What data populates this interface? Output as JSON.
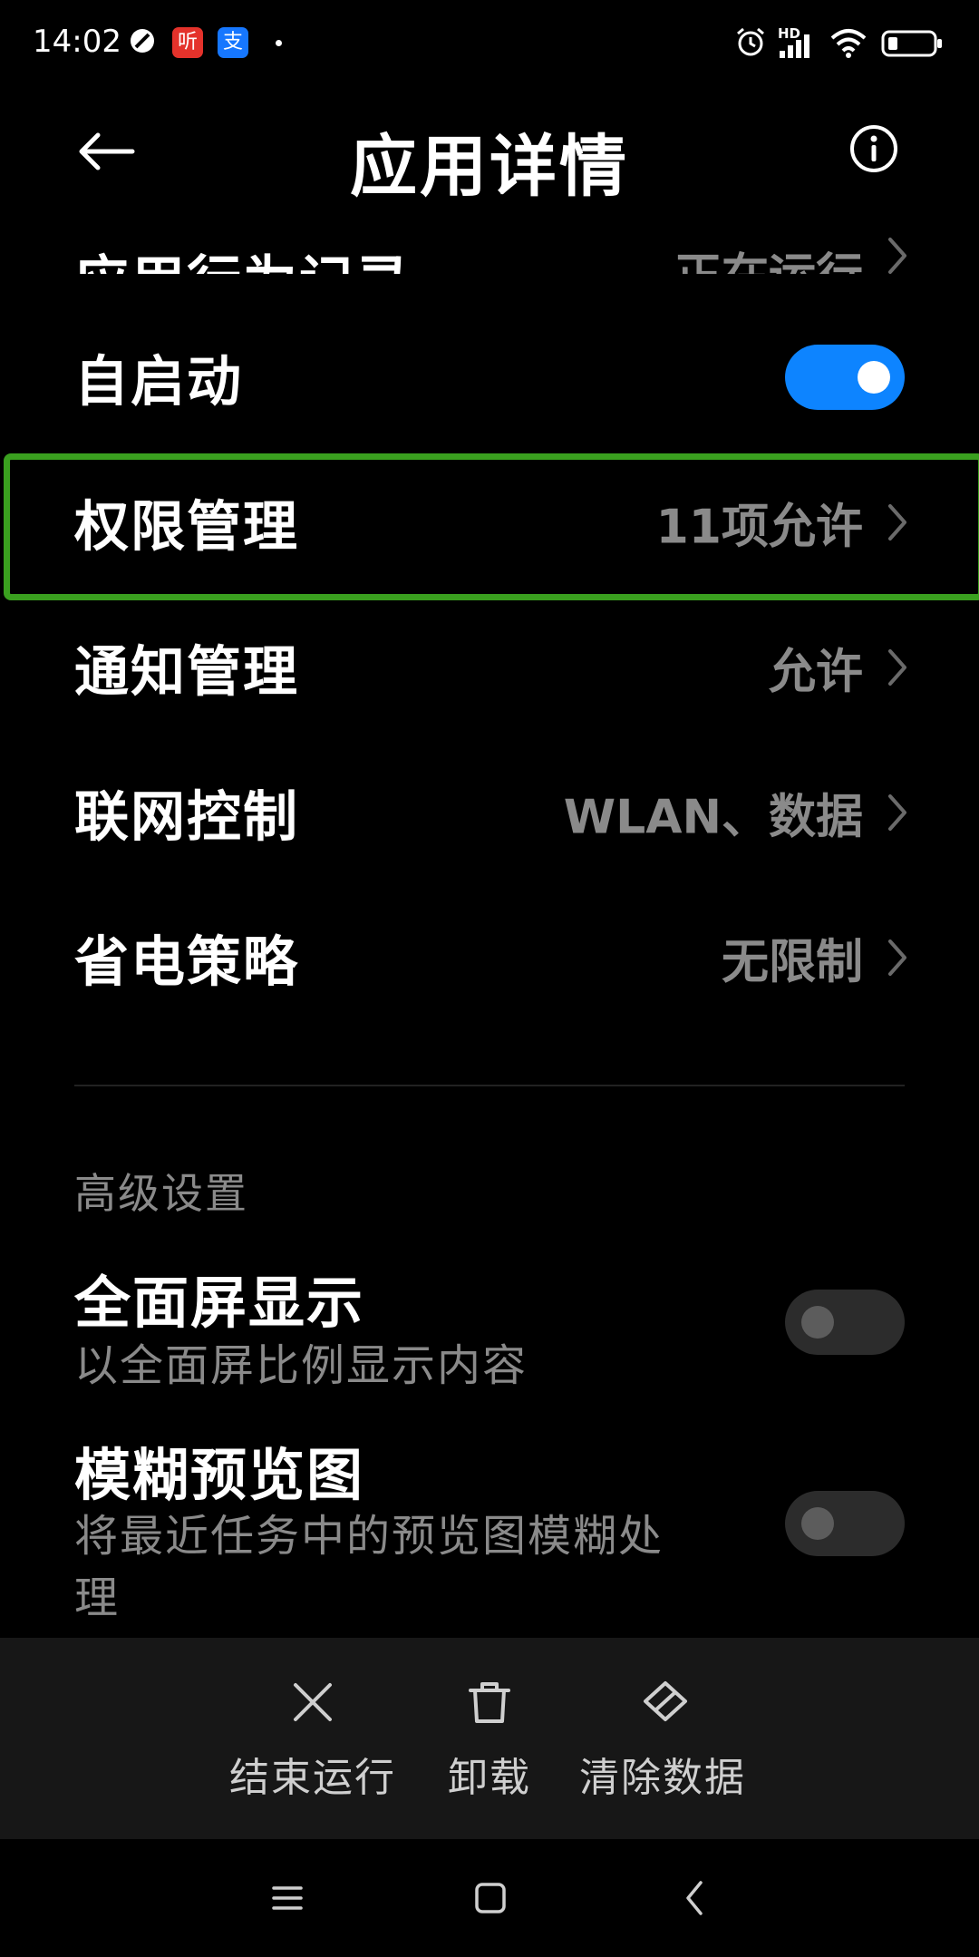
{
  "status_bar": {
    "time": "14:02",
    "badge_1": "听",
    "badge_2": "支",
    "network_label": "HD",
    "icons": [
      "block-icon",
      "listen-app-icon",
      "alipay-icon",
      "alarm-icon",
      "signal-icon",
      "wifi-icon",
      "battery-icon"
    ],
    "badge_1_color": "#e4322b",
    "badge_2_color": "#1677ff"
  },
  "header": {
    "title": "应用详情",
    "back_icon": "back-arrow-icon",
    "info_icon": "info-icon"
  },
  "rows": [
    {
      "label": "应用行为记录",
      "value": "正在运行",
      "partially_visible": true
    },
    {
      "label": "自启动",
      "toggle": true
    },
    {
      "label": "权限管理",
      "value": "11项允许",
      "highlighted": true
    },
    {
      "label": "通知管理",
      "value": "允许"
    },
    {
      "label": "联网控制",
      "value": "WLAN、数据"
    },
    {
      "label": "省电策略",
      "value": "无限制"
    }
  ],
  "advanced": {
    "section_title": "高级设置",
    "items": [
      {
        "title": "全面屏显示",
        "subtitle": "以全面屏比例显示内容",
        "toggle": false
      },
      {
        "title": "模糊预览图",
        "subtitle_line1": "将最近任务中的预览图模糊处",
        "subtitle_line2": "理",
        "toggle": false
      }
    ]
  },
  "actions": [
    {
      "label": "结束运行",
      "icon": "close-icon"
    },
    {
      "label": "卸载",
      "icon": "trash-icon"
    },
    {
      "label": "清除数据",
      "icon": "eraser-icon"
    }
  ],
  "colors": {
    "accent": "#0d84ff",
    "highlight_border": "#3aa01f",
    "secondary_text": "#8a8a8a",
    "background": "#000000",
    "action_bar": "#171717"
  }
}
